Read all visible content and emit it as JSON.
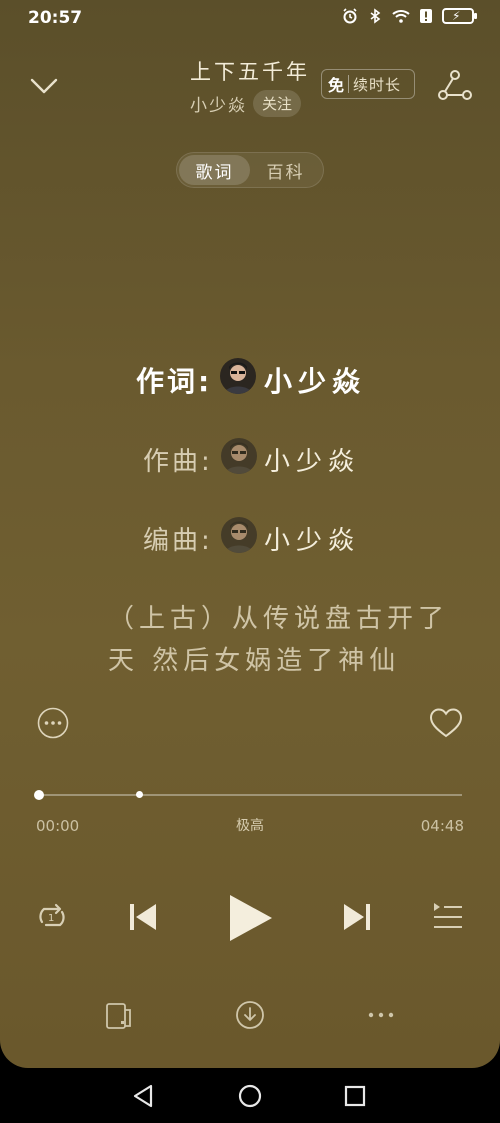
{
  "status_bar": {
    "time": "20:57"
  },
  "header": {
    "song_title": "上下五千年",
    "artist": "小少焱",
    "follow_label": "关注",
    "vip_free": "免",
    "vip_text": "续时长"
  },
  "tabs": [
    {
      "label": "歌词",
      "active": true
    },
    {
      "label": "百科",
      "active": false
    }
  ],
  "credits": [
    {
      "role": "作词:",
      "name": "小少焱"
    },
    {
      "role": "作曲:",
      "name": "小少焱"
    },
    {
      "role": "编曲:",
      "name": "小少焱"
    }
  ],
  "lyrics": [
    "（上古）从传说盘古开了",
    "天 然后女娲造了神仙"
  ],
  "player": {
    "current_time": "00:00",
    "total_time": "04:48",
    "quality": "极高",
    "progress": 0.0,
    "buffered": 0.24
  },
  "colors": {
    "background": "#6a5a2f",
    "text_primary": "#ffffff",
    "text_secondary": "#cfc4a6"
  },
  "icons": {
    "collapse": "chevron-down-icon",
    "share": "share-graph-icon",
    "more": "more-circle-icon",
    "like": "heart-icon",
    "repeat": "repeat-one-icon",
    "prev": "skip-previous-icon",
    "play": "play-icon",
    "next": "skip-next-icon",
    "playlist": "playlist-icon",
    "device": "device-cast-icon",
    "download": "download-icon",
    "menu": "more-horizontal-icon"
  }
}
